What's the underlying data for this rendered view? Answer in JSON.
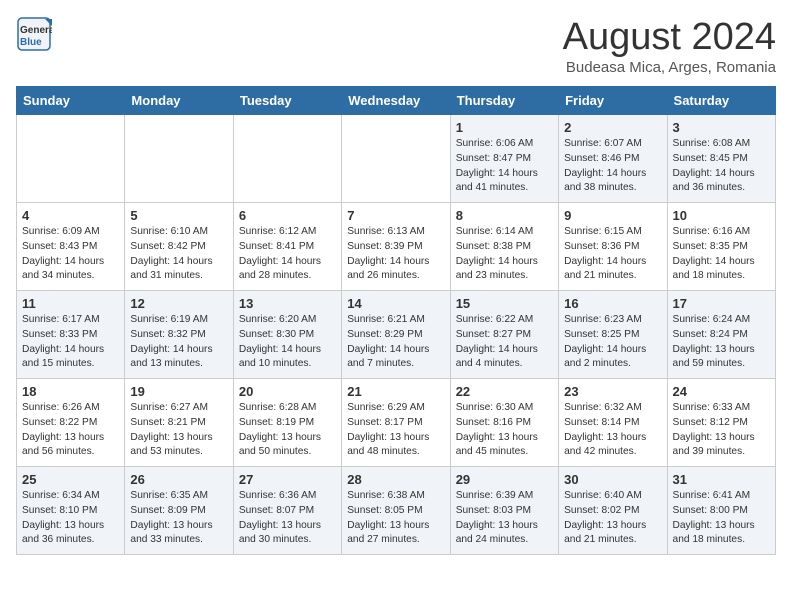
{
  "logo": {
    "text_general": "General",
    "text_blue": "Blue"
  },
  "title": "August 2024",
  "location": "Budeasa Mica, Arges, Romania",
  "days_of_week": [
    "Sunday",
    "Monday",
    "Tuesday",
    "Wednesday",
    "Thursday",
    "Friday",
    "Saturday"
  ],
  "weeks": [
    [
      {
        "day": "",
        "info": ""
      },
      {
        "day": "",
        "info": ""
      },
      {
        "day": "",
        "info": ""
      },
      {
        "day": "",
        "info": ""
      },
      {
        "day": "1",
        "info": "Sunrise: 6:06 AM\nSunset: 8:47 PM\nDaylight: 14 hours and 41 minutes."
      },
      {
        "day": "2",
        "info": "Sunrise: 6:07 AM\nSunset: 8:46 PM\nDaylight: 14 hours and 38 minutes."
      },
      {
        "day": "3",
        "info": "Sunrise: 6:08 AM\nSunset: 8:45 PM\nDaylight: 14 hours and 36 minutes."
      }
    ],
    [
      {
        "day": "4",
        "info": "Sunrise: 6:09 AM\nSunset: 8:43 PM\nDaylight: 14 hours and 34 minutes."
      },
      {
        "day": "5",
        "info": "Sunrise: 6:10 AM\nSunset: 8:42 PM\nDaylight: 14 hours and 31 minutes."
      },
      {
        "day": "6",
        "info": "Sunrise: 6:12 AM\nSunset: 8:41 PM\nDaylight: 14 hours and 28 minutes."
      },
      {
        "day": "7",
        "info": "Sunrise: 6:13 AM\nSunset: 8:39 PM\nDaylight: 14 hours and 26 minutes."
      },
      {
        "day": "8",
        "info": "Sunrise: 6:14 AM\nSunset: 8:38 PM\nDaylight: 14 hours and 23 minutes."
      },
      {
        "day": "9",
        "info": "Sunrise: 6:15 AM\nSunset: 8:36 PM\nDaylight: 14 hours and 21 minutes."
      },
      {
        "day": "10",
        "info": "Sunrise: 6:16 AM\nSunset: 8:35 PM\nDaylight: 14 hours and 18 minutes."
      }
    ],
    [
      {
        "day": "11",
        "info": "Sunrise: 6:17 AM\nSunset: 8:33 PM\nDaylight: 14 hours and 15 minutes."
      },
      {
        "day": "12",
        "info": "Sunrise: 6:19 AM\nSunset: 8:32 PM\nDaylight: 14 hours and 13 minutes."
      },
      {
        "day": "13",
        "info": "Sunrise: 6:20 AM\nSunset: 8:30 PM\nDaylight: 14 hours and 10 minutes."
      },
      {
        "day": "14",
        "info": "Sunrise: 6:21 AM\nSunset: 8:29 PM\nDaylight: 14 hours and 7 minutes."
      },
      {
        "day": "15",
        "info": "Sunrise: 6:22 AM\nSunset: 8:27 PM\nDaylight: 14 hours and 4 minutes."
      },
      {
        "day": "16",
        "info": "Sunrise: 6:23 AM\nSunset: 8:25 PM\nDaylight: 14 hours and 2 minutes."
      },
      {
        "day": "17",
        "info": "Sunrise: 6:24 AM\nSunset: 8:24 PM\nDaylight: 13 hours and 59 minutes."
      }
    ],
    [
      {
        "day": "18",
        "info": "Sunrise: 6:26 AM\nSunset: 8:22 PM\nDaylight: 13 hours and 56 minutes."
      },
      {
        "day": "19",
        "info": "Sunrise: 6:27 AM\nSunset: 8:21 PM\nDaylight: 13 hours and 53 minutes."
      },
      {
        "day": "20",
        "info": "Sunrise: 6:28 AM\nSunset: 8:19 PM\nDaylight: 13 hours and 50 minutes."
      },
      {
        "day": "21",
        "info": "Sunrise: 6:29 AM\nSunset: 8:17 PM\nDaylight: 13 hours and 48 minutes."
      },
      {
        "day": "22",
        "info": "Sunrise: 6:30 AM\nSunset: 8:16 PM\nDaylight: 13 hours and 45 minutes."
      },
      {
        "day": "23",
        "info": "Sunrise: 6:32 AM\nSunset: 8:14 PM\nDaylight: 13 hours and 42 minutes."
      },
      {
        "day": "24",
        "info": "Sunrise: 6:33 AM\nSunset: 8:12 PM\nDaylight: 13 hours and 39 minutes."
      }
    ],
    [
      {
        "day": "25",
        "info": "Sunrise: 6:34 AM\nSunset: 8:10 PM\nDaylight: 13 hours and 36 minutes."
      },
      {
        "day": "26",
        "info": "Sunrise: 6:35 AM\nSunset: 8:09 PM\nDaylight: 13 hours and 33 minutes."
      },
      {
        "day": "27",
        "info": "Sunrise: 6:36 AM\nSunset: 8:07 PM\nDaylight: 13 hours and 30 minutes."
      },
      {
        "day": "28",
        "info": "Sunrise: 6:38 AM\nSunset: 8:05 PM\nDaylight: 13 hours and 27 minutes."
      },
      {
        "day": "29",
        "info": "Sunrise: 6:39 AM\nSunset: 8:03 PM\nDaylight: 13 hours and 24 minutes."
      },
      {
        "day": "30",
        "info": "Sunrise: 6:40 AM\nSunset: 8:02 PM\nDaylight: 13 hours and 21 minutes."
      },
      {
        "day": "31",
        "info": "Sunrise: 6:41 AM\nSunset: 8:00 PM\nDaylight: 13 hours and 18 minutes."
      }
    ]
  ]
}
